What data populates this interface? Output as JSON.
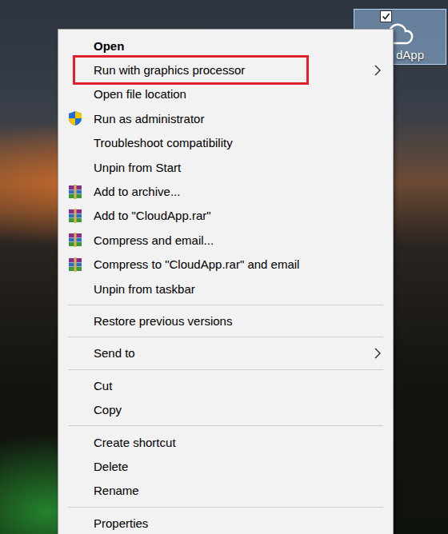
{
  "desktop_icon": {
    "label": "dApp",
    "selected": true,
    "checked": true
  },
  "context_menu": {
    "items": [
      {
        "kind": "plain",
        "label": "Open",
        "bold": true,
        "submenu": false,
        "annotated": false
      },
      {
        "kind": "plain",
        "label": "Run with graphics processor",
        "bold": false,
        "submenu": true,
        "annotated": true
      },
      {
        "kind": "plain",
        "label": "Open file location",
        "bold": false,
        "submenu": false,
        "annotated": false
      },
      {
        "kind": "shield",
        "label": "Run as administrator",
        "bold": false,
        "submenu": false,
        "annotated": false
      },
      {
        "kind": "plain",
        "label": "Troubleshoot compatibility",
        "bold": false,
        "submenu": false,
        "annotated": false
      },
      {
        "kind": "plain",
        "label": "Unpin from Start",
        "bold": false,
        "submenu": false,
        "annotated": false
      },
      {
        "kind": "archive",
        "label": "Add to archive...",
        "bold": false,
        "submenu": false,
        "annotated": false
      },
      {
        "kind": "archive",
        "label": "Add to \"CloudApp.rar\"",
        "bold": false,
        "submenu": false,
        "annotated": false
      },
      {
        "kind": "archive",
        "label": "Compress and email...",
        "bold": false,
        "submenu": false,
        "annotated": false
      },
      {
        "kind": "archive",
        "label": "Compress to \"CloudApp.rar\" and email",
        "bold": false,
        "submenu": false,
        "annotated": false
      },
      {
        "kind": "plain",
        "label": "Unpin from taskbar",
        "bold": false,
        "submenu": false,
        "annotated": false
      },
      {
        "kind": "separator"
      },
      {
        "kind": "plain",
        "label": "Restore previous versions",
        "bold": false,
        "submenu": false,
        "annotated": false
      },
      {
        "kind": "separator"
      },
      {
        "kind": "plain",
        "label": "Send to",
        "bold": false,
        "submenu": true,
        "annotated": false
      },
      {
        "kind": "separator"
      },
      {
        "kind": "plain",
        "label": "Cut",
        "bold": false,
        "submenu": false,
        "annotated": false
      },
      {
        "kind": "plain",
        "label": "Copy",
        "bold": false,
        "submenu": false,
        "annotated": false
      },
      {
        "kind": "separator"
      },
      {
        "kind": "plain",
        "label": "Create shortcut",
        "bold": false,
        "submenu": false,
        "annotated": false
      },
      {
        "kind": "plain",
        "label": "Delete",
        "bold": false,
        "submenu": false,
        "annotated": false
      },
      {
        "kind": "plain",
        "label": "Rename",
        "bold": false,
        "submenu": false,
        "annotated": false
      },
      {
        "kind": "separator"
      },
      {
        "kind": "plain",
        "label": "Properties",
        "bold": false,
        "submenu": false,
        "annotated": false
      }
    ]
  }
}
